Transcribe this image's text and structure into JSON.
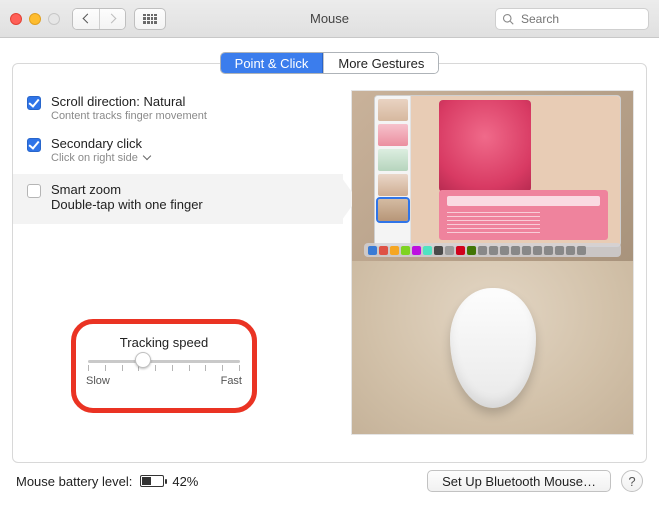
{
  "window": {
    "title": "Mouse"
  },
  "search": {
    "placeholder": "Search"
  },
  "tabs": {
    "point_click": "Point & Click",
    "more_gestures": "More Gestures"
  },
  "options": {
    "scroll": {
      "title": "Scroll direction: Natural",
      "sub": "Content tracks finger movement"
    },
    "secondary": {
      "title": "Secondary click",
      "sub": "Click on right side"
    },
    "smartzoom": {
      "title": "Smart zoom",
      "sub": "Double-tap with one finger"
    }
  },
  "tracking": {
    "title": "Tracking speed",
    "slow": "Slow",
    "fast": "Fast",
    "position_pct": 36,
    "ticks": 10
  },
  "battery": {
    "label": "Mouse battery level:",
    "pct_text": "42%",
    "pct": 42
  },
  "buttons": {
    "bluetooth": "Set Up Bluetooth Mouse…",
    "help": "?"
  },
  "colors": {
    "accent": "#3b7ded",
    "highlight": "#ea3323"
  },
  "preview": {
    "dock_count": 20
  }
}
